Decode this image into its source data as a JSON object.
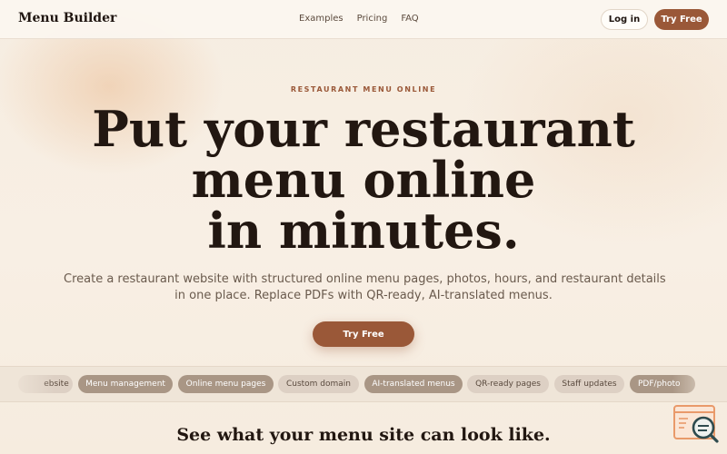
{
  "header": {
    "logo": "Menu Builder",
    "nav": [
      "Examples",
      "Pricing",
      "FAQ"
    ],
    "login_label": "Log in",
    "try_label": "Try Free"
  },
  "hero": {
    "eyebrow": "RESTAURANT MENU ONLINE",
    "headline_lines": [
      "Put your restaurant",
      "menu online",
      "in minutes."
    ],
    "subtext_lines": [
      "Create a restaurant website with structured online menu pages, photos, hours, and restaurant details",
      "in one place. Replace PDFs with QR-ready, AI-translated menus."
    ],
    "cta_label": "Try Free"
  },
  "features": {
    "chips": [
      "ebsite",
      "Menu management",
      "Online menu pages",
      "Custom domain",
      "AI-translated menus",
      "QR-ready pages",
      "Staff updates",
      "PDF/photo"
    ]
  },
  "preview": {
    "title": "See what your menu site can look like."
  },
  "widget": {
    "icon": "search-window-icon"
  },
  "colors": {
    "accent": "#9a5838",
    "background": "#f7efe3",
    "text": "#221711"
  }
}
